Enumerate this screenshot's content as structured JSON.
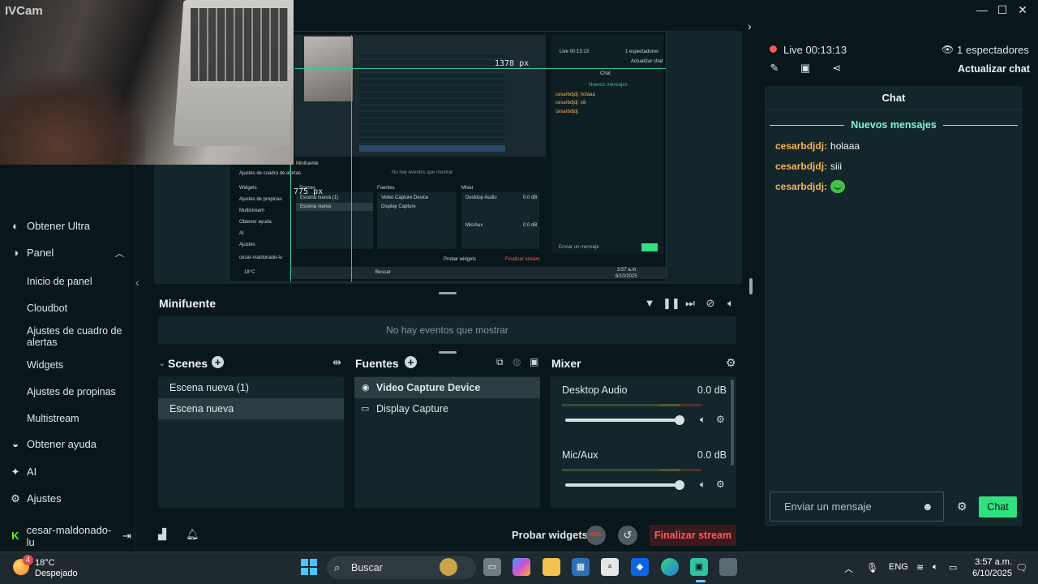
{
  "webcam": {
    "label": "IVCam"
  },
  "sidebar": {
    "items": [
      {
        "label": "Obtener Ultra",
        "icon": "ultra-icon"
      },
      {
        "label": "Panel",
        "icon": "panel-icon"
      },
      {
        "label": "Inicio de panel"
      },
      {
        "label": "Cloudbot"
      },
      {
        "label": "Ajustes de cuadro de alertas"
      },
      {
        "label": "Widgets"
      },
      {
        "label": "Ajustes de propinas"
      },
      {
        "label": "Multistream"
      },
      {
        "label": "Obtener ayuda",
        "icon": "help-icon"
      },
      {
        "label": "AI",
        "icon": "ai-icon"
      },
      {
        "label": "Ajustes",
        "icon": "settings-icon"
      },
      {
        "label": "cesar-maldonado-lu",
        "icon": "kick-icon"
      }
    ]
  },
  "preview": {
    "px_label_width": "1378 px",
    "px_label_height": "775 px",
    "mini": {
      "live": "Live 00:13:13",
      "viewers": "1 espectadores",
      "update": "Actualizar chat",
      "chat": "Chat",
      "new": "Nuevos mensajes",
      "m1": "cesarbdjdj: holaaa",
      "m2": "cesarbdjdj: siii",
      "m3": "cesarbdjdj:",
      "minifuente": "Minifuente",
      "no_events": "No hay eventos que mostrar",
      "scenes": "Scenes",
      "fuentes": "Fuentes",
      "mixer": "Mixer",
      "scene1": "Escena nueva (1)",
      "scene2": "Escena nueva",
      "src1": "Video Capture Device",
      "src2": "Display Capture",
      "desk": "Desktop Audio",
      "mic": "Mic/Aux",
      "db": "0.0 dB",
      "probar": "Probar widgets",
      "end": "Finalizar stream",
      "enviar": "Enviar un mensaje",
      "user": "cesar-maldonado-lu",
      "help": "Obtener ayuda",
      "ai": "AI",
      "ajustes": "Ajustes",
      "alertas": "Ajustes de cuadro de alertas",
      "widgets": "Widgets",
      "propinas": "Ajustes de propinas",
      "multistream": "Multistream",
      "buscar": "Buscar",
      "temp": "18°C",
      "despejado": "Despejado",
      "time": "3:57 a.m.",
      "date": "6/10/2025"
    }
  },
  "minifuente": {
    "title": "Minifuente",
    "empty": "No hay eventos que mostrar"
  },
  "scenes": {
    "title": "Scenes",
    "items": [
      "Escena nueva (1)",
      "Escena nueva"
    ],
    "selected": 1
  },
  "fuentes": {
    "title": "Fuentes",
    "items": [
      "Video Capture Device",
      "Display Capture"
    ]
  },
  "mixer": {
    "title": "Mixer",
    "channels": [
      {
        "name": "Desktop Audio",
        "db": "0.0 dB",
        "volume": 1.0
      },
      {
        "name": "Mic/Aux",
        "db": "0.0 dB",
        "volume": 1.0
      }
    ]
  },
  "footer": {
    "probar": "Probar widgets",
    "rec": "REC",
    "end": "Finalizar stream"
  },
  "right": {
    "live": "Live 00:13:13",
    "viewers": "1 espectadores",
    "update_chat": "Actualizar chat",
    "chat_title": "Chat",
    "new_messages": "Nuevos mensajes",
    "messages": [
      {
        "user": "cesarbdjdj:",
        "text": "holaaa"
      },
      {
        "user": "cesarbdjdj:",
        "text": "siii"
      },
      {
        "user": "cesarbdjdj:",
        "text": "",
        "emote": true
      }
    ],
    "input_placeholder": "Enviar un mensaje",
    "send": "Chat"
  },
  "taskbar": {
    "weather_temp": "18°C",
    "weather_desc": "Despejado",
    "weather_badge": "4",
    "search": "Buscar",
    "lang": "ENG",
    "time": "3:57 a.m.",
    "date": "6/10/2025"
  },
  "colors": {
    "background": "#09161a",
    "panel": "#12262c",
    "accent": "#80f5d2",
    "chat_button": "#31e07f",
    "danger": "#ff5a5a",
    "username": "#f5b35a"
  }
}
